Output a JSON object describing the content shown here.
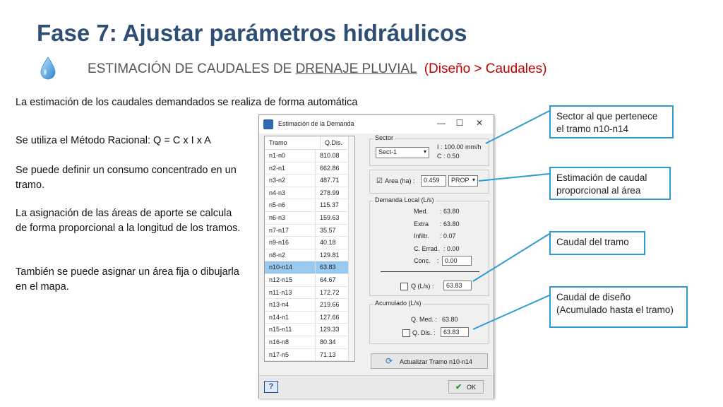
{
  "slide": {
    "title": "Fase 7: Ajustar parámetros hidráulicos",
    "subtitle_pre": "ESTIMACIÓN DE CAUDALES DE ",
    "subtitle_link": "DRENAJE PLUVIAL",
    "subtitle_red": "(Diseño > Caudales)",
    "intro": "La estimación de los caudales demandados se realiza de forma automática",
    "p1": "Se utiliza el Método Racional:  Q = C x I x A",
    "p2": "Se puede definir un consumo concentrado en un tramo.",
    "p3": "La asignación de las áreas de aporte se calcula de forma proporcional a la longitud de los tramos.",
    "p4": "También se puede asignar un área fija o dibujarla en el mapa."
  },
  "dialog": {
    "title": "Estimación de la Demanda",
    "minimize": "—",
    "maximize": "☐",
    "close": "✕",
    "table": {
      "headers": [
        "Tramo",
        "Q.Dis."
      ],
      "rows": [
        [
          "n1-n0",
          "810.08"
        ],
        [
          "n2-n1",
          "662.86"
        ],
        [
          "n3-n2",
          "487.71"
        ],
        [
          "n4-n3",
          "278.99"
        ],
        [
          "n5-n6",
          "115.37"
        ],
        [
          "n6-n3",
          "159.63"
        ],
        [
          "n7-n17",
          "35.57"
        ],
        [
          "n9-n16",
          "40.18"
        ],
        [
          "n8-n2",
          "129.81"
        ],
        [
          "n10-n14",
          "63.83"
        ],
        [
          "n12-n15",
          "64.67"
        ],
        [
          "n11-n13",
          "172.72"
        ],
        [
          "n13-n4",
          "219.66"
        ],
        [
          "n14-n1",
          "127.66"
        ],
        [
          "n15-n11",
          "129.33"
        ],
        [
          "n16-n8",
          "80.34"
        ],
        [
          "n17-n5",
          "71.13"
        ]
      ],
      "selected_index": 9
    },
    "sector": {
      "label": "Sector",
      "value": "Sect-1",
      "i_text": "I : 100.00 mm/h",
      "c_text": "C : 0.50"
    },
    "area": {
      "label": "Area (ha) :",
      "value": "0.459",
      "mode": "PROP",
      "checked": "☑"
    },
    "demanda_local": {
      "label": "Demanda Local (L/s)",
      "med": "Med.",
      "med_val": ": 63.80",
      "extra": "Extra",
      "extra_val": ": 63.80",
      "infiltr": "Infiltr.",
      "infiltr_val": ": 0.07",
      "cerrad": "C. Errad.",
      "cerrad_val": ": 0.00",
      "conc": "Conc.",
      "conc_colon": ":",
      "conc_val": "0.00",
      "q_label": "Q (L/s) :",
      "q_val": "63.83"
    },
    "acumulado": {
      "label": "Acumulado (L/s)",
      "qmed": "Q. Med. :",
      "qmed_val": "63.80",
      "qdis": "Q. Dis. :",
      "qdis_val": "63.83"
    },
    "update_button": "Actualizar Tramo n10-n14",
    "help_button": "?",
    "ok_button": "OK"
  },
  "callouts": {
    "sector": "Sector al que pertenece el tramo n10-n14",
    "area": "Estimación de caudal proporcional al área",
    "caudal": "Caudal del tramo",
    "diseno": "Caudal de diseño (Acumulado hasta el tramo)"
  },
  "colors": {
    "title": "#2f4e74",
    "red": "#c00000",
    "callout_border": "#2e9bd2",
    "selected_row": "#99c9ef"
  }
}
